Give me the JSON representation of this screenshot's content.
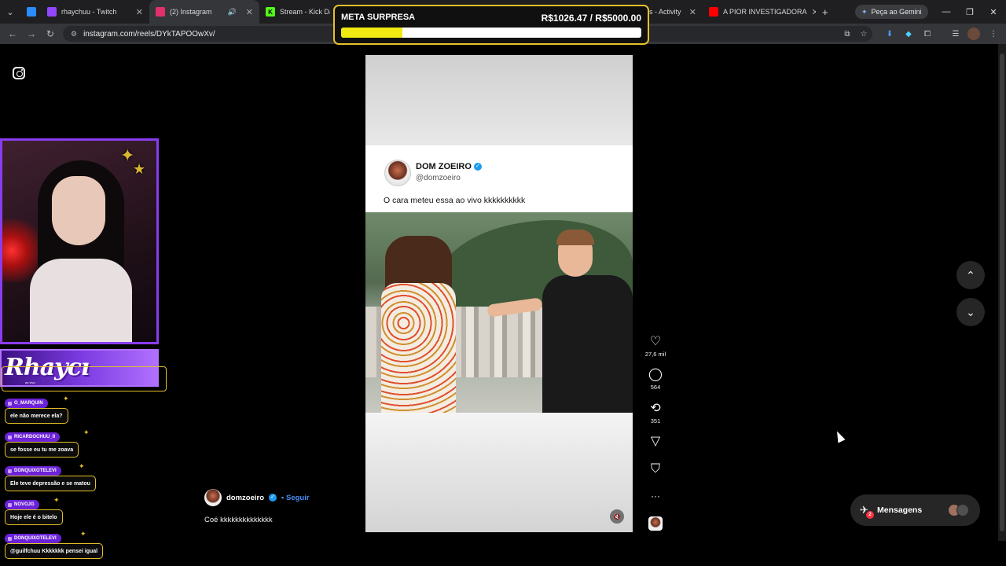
{
  "browser": {
    "tabs": [
      {
        "title": "rhaychuu - Twitch",
        "favicon_color": "#9146ff",
        "active": false
      },
      {
        "title": "(2) Instagram",
        "favicon_color": "#e1306c",
        "active": true
      },
      {
        "title": "Stream - Kick Dash",
        "favicon_color": "#53fc18",
        "active": false
      },
      {
        "title": "s - Activity",
        "favicon_color": "#888888",
        "active": false
      },
      {
        "title": "A PIOR INVESTIGADORA",
        "favicon_color": "#ff0000",
        "active": false
      }
    ],
    "new_tab_label": "+",
    "gemini_label": "Peça ao Gemini",
    "url": "instagram.com/reels/DYkTAPOOwXv/",
    "window_controls": {
      "minimize": "—",
      "restore": "❐",
      "close": "✕"
    }
  },
  "overlay": {
    "goal": {
      "title": "META SURPRESA",
      "amount_label": "R$1026.47 / R$5000.00",
      "progress": 0.205,
      "fill_color": "#f0ea12",
      "border_color": "#e6c02a"
    },
    "banner": {
      "title": "Rhaycı",
      "subtitle": "ao vivo"
    },
    "chat": [
      {
        "user": "O_MARQUIN",
        "message": "ele não merece ela?"
      },
      {
        "user": "RICARDOCHUU_II",
        "message": "se fosse eu tu me zoava"
      },
      {
        "user": "DONQUIXOTELEVI",
        "message": "Ele teve depressão e se matou"
      },
      {
        "user": "NOVOJG",
        "message": "Hoje ele é o bitelo"
      },
      {
        "user": "DONQUIXOTELEVI",
        "message": "@guilfchuu Kkkkkkk pensei igual"
      }
    ]
  },
  "reel": {
    "tweet": {
      "name": "DOM ZOEIRO",
      "handle": "@domzoeiro",
      "text": "O cara meteu essa ao vivo kkkkkkkkkk"
    },
    "actions": [
      {
        "icon": "heart-icon",
        "glyph": "♡",
        "count": "27,6 mil"
      },
      {
        "icon": "comment-icon",
        "glyph": "◯",
        "count": "564"
      },
      {
        "icon": "repost-icon",
        "glyph": "⟲",
        "count": "351"
      },
      {
        "icon": "share-icon",
        "glyph": "▽",
        "count": ""
      },
      {
        "icon": "bookmark-icon",
        "glyph": "⛉",
        "count": ""
      },
      {
        "icon": "more-icon",
        "glyph": "···",
        "count": ""
      }
    ],
    "author": "domzoeiro",
    "follow_label": "• Seguir",
    "caption": "Coé kkkkkkkkkkkkkk"
  },
  "messages": {
    "label": "Mensagens",
    "badge": "2"
  }
}
